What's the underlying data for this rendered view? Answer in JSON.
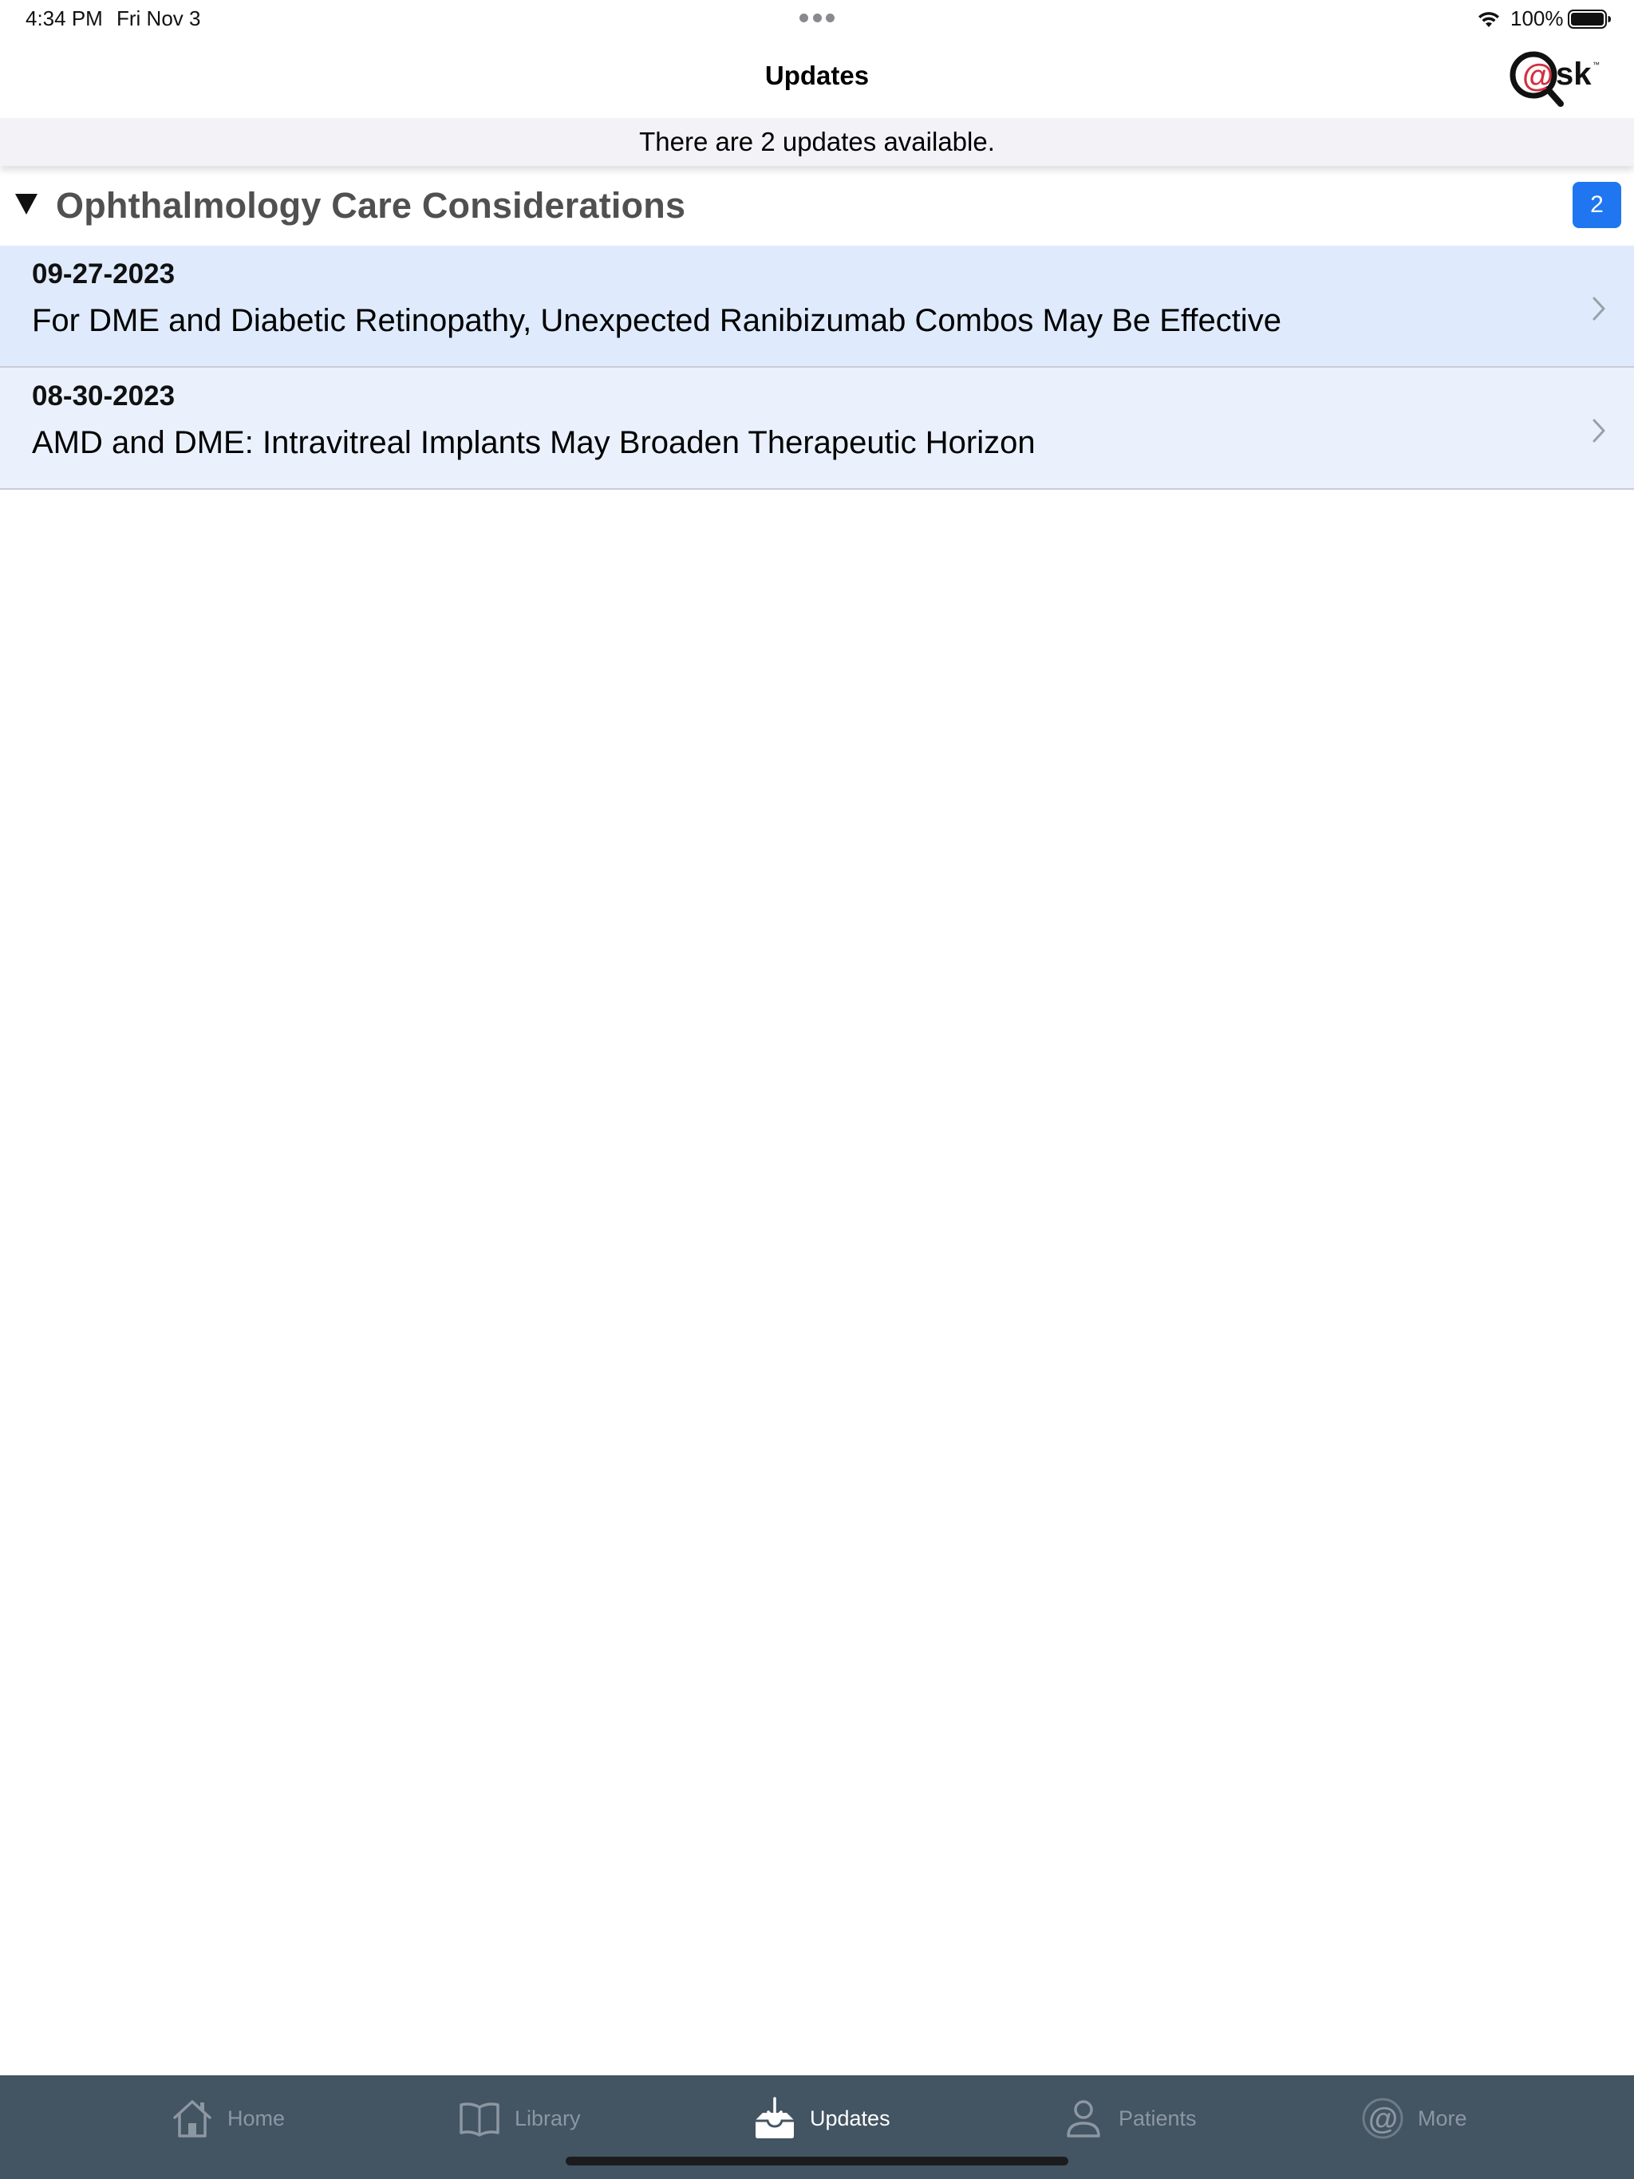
{
  "status_bar": {
    "time": "4:34 PM",
    "date": "Fri Nov 3",
    "battery": "100%"
  },
  "nav": {
    "title": "Updates",
    "logo_text": "@sk"
  },
  "banner": {
    "text": "There are 2 updates available."
  },
  "section": {
    "title": "Ophthalmology Care Considerations",
    "count": "2"
  },
  "updates": [
    {
      "date": "09-27-2023",
      "title": "For DME and Diabetic Retinopathy, Unexpected Ranibizumab Combos May Be Effective"
    },
    {
      "date": "08-30-2023",
      "title": "AMD and DME: Intravitreal Implants May Broaden Therapeutic Horizon"
    }
  ],
  "tab_bar": {
    "items": [
      {
        "label": "Home",
        "icon": "home-icon"
      },
      {
        "label": "Library",
        "icon": "book-icon"
      },
      {
        "label": "Updates",
        "icon": "inbox-download-icon",
        "active": true
      },
      {
        "label": "Patients",
        "icon": "person-icon"
      },
      {
        "label": "More",
        "icon": "at-icon"
      }
    ]
  },
  "colors": {
    "accent": "#1f76f0",
    "tab_bar_bg": "#435462",
    "row_highlight": "#dfeafc",
    "row_alt": "#eaf1fd",
    "logo_red": "#d32f3f"
  }
}
